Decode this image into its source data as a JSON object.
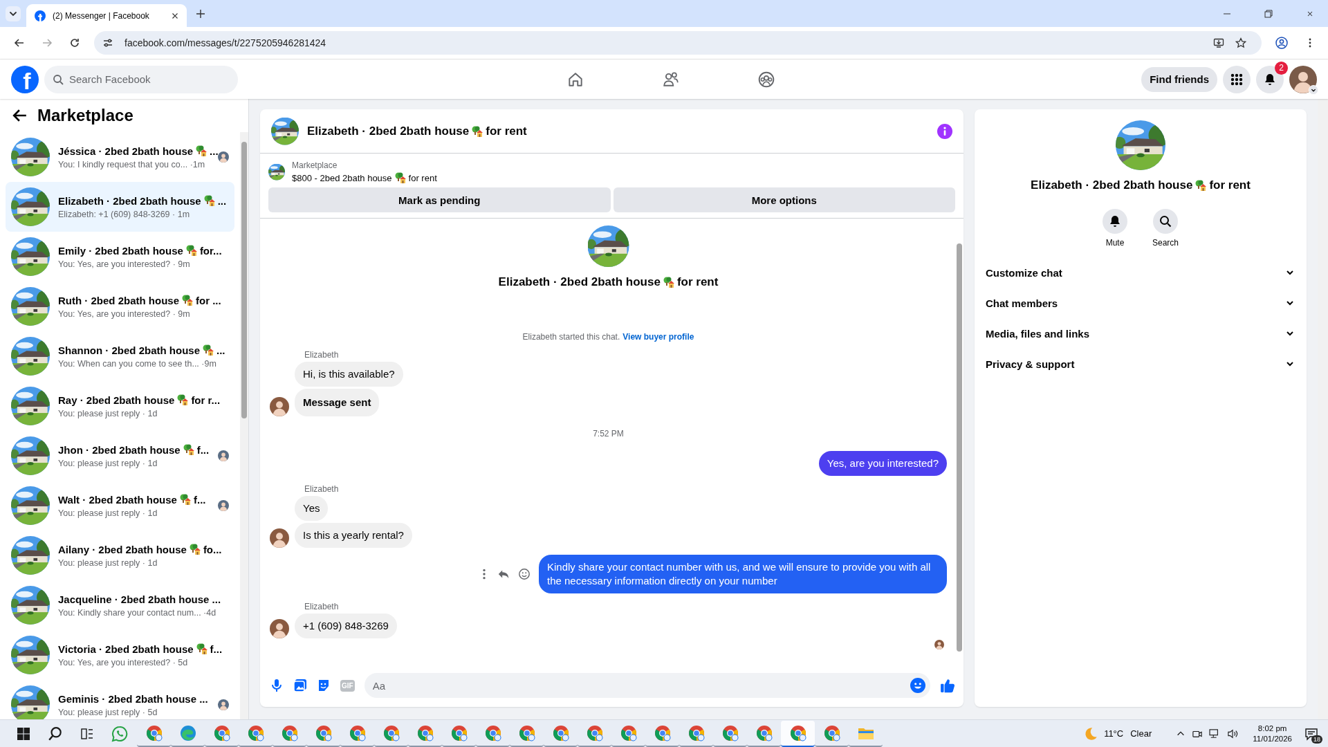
{
  "browser": {
    "tab_title": "(2) Messenger | Facebook",
    "url": "facebook.com/messages/t/2275205946281424"
  },
  "header": {
    "logo": "f",
    "search_placeholder": "Search Facebook",
    "nav": [
      {
        "kind": "home"
      },
      {
        "kind": "friends"
      },
      {
        "kind": "groups"
      }
    ],
    "find_friends": "Find friends",
    "notifications_badge": "2"
  },
  "sidebar": {
    "title": "Marketplace",
    "conversations": [
      {
        "title": "Jéssica · 2bed 2bath house",
        "emoji": true,
        "title_end": "...",
        "preview": "You: I kindly request that you co... ·1m",
        "seen": true,
        "selected": false
      },
      {
        "title": "Elizabeth · 2bed 2bath house",
        "emoji": true,
        "title_end": "...",
        "preview": "Elizabeth: +1 (609) 848-3269 · 1m",
        "seen": false,
        "selected": true
      },
      {
        "title": "Emily · 2bed 2bath house",
        "emoji": true,
        "title_end": "for...",
        "preview": "You: Yes, are you interested? · 9m",
        "seen": false,
        "selected": false
      },
      {
        "title": "Ruth · 2bed 2bath house",
        "emoji": true,
        "title_end": "for ...",
        "preview": "You: Yes, are you interested? · 9m",
        "seen": false,
        "selected": false
      },
      {
        "title": "Shannon · 2bed 2bath house",
        "emoji": true,
        "title_end": "...",
        "preview": "You: When can you come to see th... ·9m",
        "seen": false,
        "selected": false
      },
      {
        "title": "Ray · 2bed 2bath house",
        "emoji": true,
        "title_end": "for r...",
        "preview": "You: please just reply · 1d",
        "seen": false,
        "selected": false
      },
      {
        "title": "Jhon · 2bed 2bath house",
        "emoji": true,
        "title_end": "f...",
        "preview": "You: please just reply · 1d",
        "seen": true,
        "selected": false
      },
      {
        "title": "Walt · 2bed 2bath house",
        "emoji": true,
        "title_end": "f...",
        "preview": "You: please just reply · 1d",
        "seen": true,
        "selected": false
      },
      {
        "title": "Ailany · 2bed 2bath house",
        "emoji": true,
        "title_end": "fo...",
        "preview": "You: please just reply · 1d",
        "seen": false,
        "selected": false
      },
      {
        "title": "Jacqueline · 2bed 2bath house ...",
        "emoji": false,
        "preview": "You: Kindly share your contact num... ·4d",
        "seen": false,
        "selected": false
      },
      {
        "title": "Victoria · 2bed 2bath house",
        "emoji": true,
        "title_end": "f...",
        "preview": "You: Yes, are you interested? · 5d",
        "seen": false,
        "selected": false
      },
      {
        "title": "Geminis · 2bed 2bath house ...",
        "emoji": false,
        "preview": "You: please just reply · 5d",
        "seen": true,
        "selected": false
      }
    ]
  },
  "chat": {
    "title": "Elizabeth · 2bed 2bath house",
    "emoji": true,
    "title_end": "for rent",
    "listing": {
      "label": "Marketplace",
      "title": "$800 - 2bed 2bath house",
      "emoji": true,
      "title_end": "for rent"
    },
    "actions": [
      "Mark as pending",
      "More options"
    ],
    "intro": {
      "title": "Elizabeth · 2bed 2bath house",
      "emoji": true,
      "title_end": "for rent",
      "note": "Elizabeth started this chat.",
      "link": "View buyer profile"
    },
    "timeline": [
      {
        "kind": "incoming",
        "sender": "Elizabeth",
        "messages": [
          {
            "text": "Hi, is this available?",
            "bold": false
          },
          {
            "text": "Message sent",
            "bold": true
          }
        ]
      },
      {
        "kind": "time",
        "text": "7:52 PM"
      },
      {
        "kind": "outgoing",
        "messages": [
          {
            "text": "Yes, are you interested?",
            "color": "#4d3ff0",
            "hover_actions": false
          }
        ]
      },
      {
        "kind": "incoming",
        "sender": "Elizabeth",
        "messages": [
          {
            "text": "Yes",
            "bold": false
          },
          {
            "text": "Is this a yearly rental?",
            "bold": false
          }
        ]
      },
      {
        "kind": "outgoing",
        "messages": [
          {
            "text": "Kindly share your contact number with us, and we will ensure to provide you with all the necessary information directly on your number",
            "color": "#2361f3",
            "hover_actions": true
          }
        ]
      },
      {
        "kind": "incoming",
        "sender": "Elizabeth",
        "messages": [
          {
            "text": "+1 (609) 848-3269",
            "bold": false
          }
        ]
      }
    ],
    "composer": {
      "gif": "GIF",
      "placeholder": "Aa"
    }
  },
  "details": {
    "title": "Elizabeth · 2bed 2bath house",
    "emoji": true,
    "title_end": "for rent",
    "buttons": [
      {
        "kind": "mute",
        "label": "Mute"
      },
      {
        "kind": "search",
        "label": "Search"
      }
    ],
    "sections": [
      {
        "label": "Customize chat",
        "expanded": false
      },
      {
        "label": "Chat members",
        "expanded": false
      },
      {
        "label": "Media, files and links",
        "expanded": false
      },
      {
        "label": "Privacy & support",
        "expanded": false
      }
    ]
  },
  "taskbar": {
    "apps": [
      {
        "kind": "chrome",
        "active": false
      },
      {
        "kind": "edge",
        "active": false
      },
      {
        "kind": "chrome",
        "active": false
      },
      {
        "kind": "chrome",
        "active": false
      },
      {
        "kind": "chrome",
        "active": false
      },
      {
        "kind": "chrome",
        "active": false
      },
      {
        "kind": "chrome",
        "active": false
      },
      {
        "kind": "chrome",
        "active": false
      },
      {
        "kind": "chrome",
        "active": false
      },
      {
        "kind": "chrome",
        "active": false
      },
      {
        "kind": "chrome",
        "active": false
      },
      {
        "kind": "chrome",
        "active": false
      },
      {
        "kind": "chrome",
        "active": false
      },
      {
        "kind": "chrome",
        "active": false
      },
      {
        "kind": "chrome",
        "active": false
      },
      {
        "kind": "chrome",
        "active": false
      },
      {
        "kind": "chrome",
        "active": false
      },
      {
        "kind": "chrome",
        "active": false
      },
      {
        "kind": "chrome",
        "active": false
      },
      {
        "kind": "chrome",
        "active": true
      },
      {
        "kind": "chrome",
        "active": false
      },
      {
        "kind": "folder",
        "active": false
      }
    ],
    "weather": {
      "temperature": "11°C",
      "condition": "Clear"
    },
    "time": "8:02 pm",
    "date": "11/01/2026",
    "notifications": "18"
  }
}
